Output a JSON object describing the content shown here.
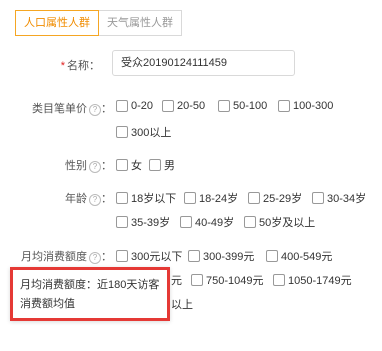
{
  "tabs": [
    "人口属性人群",
    "天气属性人群"
  ],
  "form": {
    "name": {
      "label": "名称：",
      "required_mark": "*",
      "value": "受众20190124111459"
    },
    "price": {
      "label": "类目笔单价",
      "help": "?",
      "suffix": "：",
      "options": [
        "0-20",
        "20-50",
        "50-100",
        "100-300",
        "300以上"
      ]
    },
    "gender": {
      "label": "性别",
      "help": "?",
      "suffix": "：",
      "options": [
        "女",
        "男"
      ]
    },
    "age": {
      "label": "年龄",
      "help": "?",
      "suffix": "：",
      "options": [
        "18岁以下",
        "18-24岁",
        "25-29岁",
        "30-34岁",
        "35-39岁",
        "40-49岁",
        "50岁及以上"
      ]
    },
    "spend": {
      "label": "月均消费额度",
      "help": "?",
      "suffix": "：",
      "options": [
        "300元以下",
        "300-399元",
        "400-549元",
        "750-1049元",
        "1050-1749元"
      ],
      "partial_texts": [
        "元",
        "以上"
      ]
    }
  },
  "tooltip": {
    "line1": "月均消费额度：近180天访客",
    "line2": "消费额均值"
  },
  "colors": {
    "active_tab": "#f5a623",
    "highlight_border": "#e53935",
    "required": "#e02020"
  }
}
